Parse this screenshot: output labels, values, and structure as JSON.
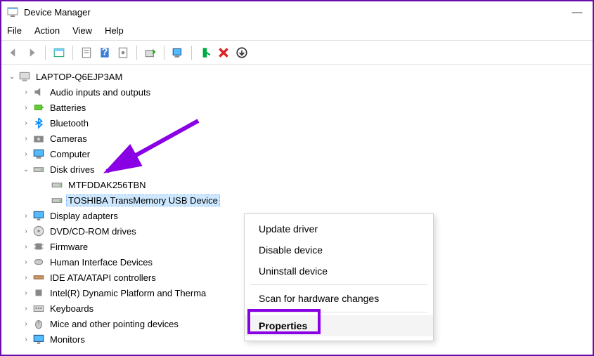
{
  "window": {
    "title": "Device Manager"
  },
  "menubar": [
    "File",
    "Action",
    "View",
    "Help"
  ],
  "tree": {
    "root": "LAPTOP-Q6EJP3AM",
    "categories": [
      {
        "name": "Audio inputs and outputs"
      },
      {
        "name": "Batteries"
      },
      {
        "name": "Bluetooth"
      },
      {
        "name": "Cameras"
      },
      {
        "name": "Computer"
      },
      {
        "name": "Disk drives",
        "expanded": true
      },
      {
        "name": "Display adapters"
      },
      {
        "name": "DVD/CD-ROM drives"
      },
      {
        "name": "Firmware"
      },
      {
        "name": "Human Interface Devices"
      },
      {
        "name": "IDE ATA/ATAPI controllers"
      },
      {
        "name": "Intel(R) Dynamic Platform and Therma"
      },
      {
        "name": "Keyboards"
      },
      {
        "name": "Mice and other pointing devices"
      },
      {
        "name": "Monitors"
      }
    ],
    "disk_children": [
      {
        "name": "MTFDDAK256TBN"
      },
      {
        "name": "TOSHIBA TransMemory USB Device",
        "selected": true
      }
    ]
  },
  "context_menu": {
    "items": [
      "Update driver",
      "Disable device",
      "Uninstall device",
      "Scan for hardware changes",
      "Properties"
    ]
  }
}
